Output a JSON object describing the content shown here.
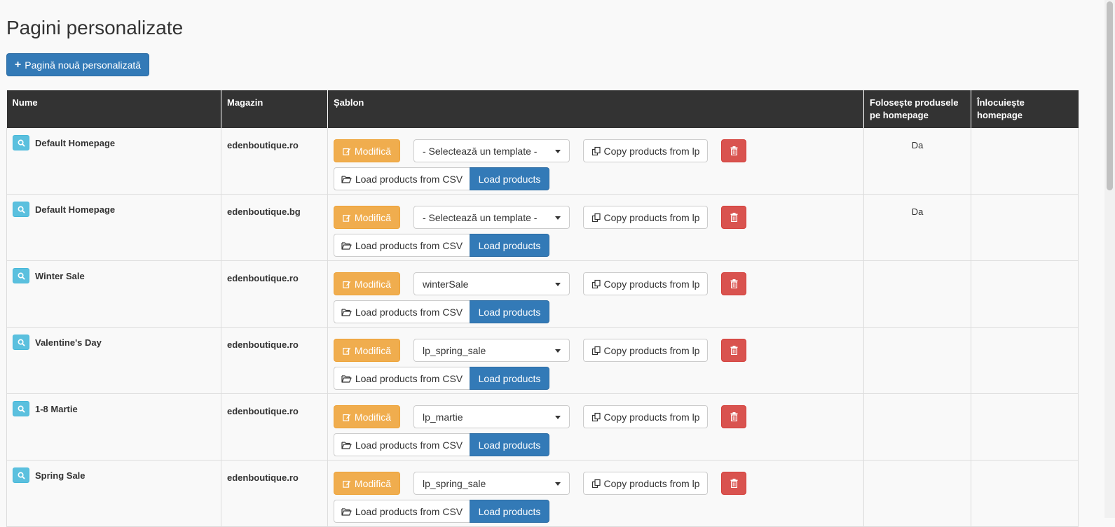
{
  "page": {
    "title": "Pagini personalizate",
    "new_button_label": "Pagină nouă personalizată"
  },
  "table": {
    "headers": [
      "Nume",
      "Magazin",
      "Șablon",
      "Folosește produsele pe homepage",
      "Înlocuiește homepage"
    ],
    "buttons": {
      "edit": "Modifică",
      "copy": "Copy products from lp",
      "csv": "Load products from CSV",
      "load": "Load products"
    },
    "rows": [
      {
        "name": "Default Homepage",
        "store": "edenboutique.ro",
        "template": "- Selectează un template -",
        "uses_homepage": "Da",
        "replaces_homepage": ""
      },
      {
        "name": "Default Homepage",
        "store": "edenboutique.bg",
        "template": "- Selectează un template -",
        "uses_homepage": "Da",
        "replaces_homepage": ""
      },
      {
        "name": "Winter Sale",
        "store": "edenboutique.ro",
        "template": "winterSale",
        "uses_homepage": "",
        "replaces_homepage": ""
      },
      {
        "name": "Valentine's Day",
        "store": "edenboutique.ro",
        "template": "lp_spring_sale",
        "uses_homepage": "",
        "replaces_homepage": ""
      },
      {
        "name": "1-8 Martie",
        "store": "edenboutique.ro",
        "template": "lp_martie",
        "uses_homepage": "",
        "replaces_homepage": ""
      },
      {
        "name": "Spring Sale",
        "store": "edenboutique.ro",
        "template": "lp_spring_sale",
        "uses_homepage": "",
        "replaces_homepage": ""
      }
    ]
  },
  "colors": {
    "primary": "#337ab7",
    "warning": "#f0ad4e",
    "danger": "#d9534f",
    "info": "#5bc0de",
    "header_bg": "#333333"
  },
  "icons": {
    "new": "plus-icon",
    "view": "search-icon",
    "edit": "edit-icon",
    "copy": "copy-icon",
    "delete": "trash-icon",
    "csv": "folder-open-icon",
    "select": "caret-down-icon"
  }
}
